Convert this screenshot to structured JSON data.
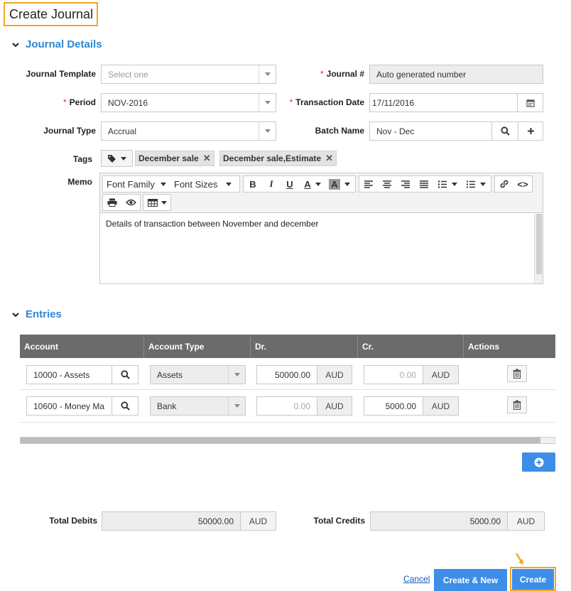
{
  "page": {
    "title": "Create Journal"
  },
  "journal_details": {
    "heading": "Journal Details",
    "journal_template": {
      "label": "Journal Template",
      "placeholder": "Select one"
    },
    "journal_number": {
      "label": "Journal #",
      "value": "Auto generated number"
    },
    "period": {
      "label": "Period",
      "value": "NOV-2016"
    },
    "transaction_date": {
      "label": "Transaction Date",
      "value": "17/11/2016"
    },
    "journal_type": {
      "label": "Journal Type",
      "value": "Accrual"
    },
    "batch_name": {
      "label": "Batch Name",
      "value": "Nov - Dec"
    },
    "tags": {
      "label": "Tags",
      "items": [
        "December sale",
        "December sale,Estimate"
      ]
    },
    "memo": {
      "label": "Memo",
      "toolbar": {
        "font_family": "Font Family",
        "font_sizes": "Font Sizes"
      },
      "content": "Details of  transaction between November and december"
    }
  },
  "entries": {
    "heading": "Entries",
    "columns": [
      "Account",
      "Account Type",
      "Dr.",
      "Cr.",
      "Actions"
    ],
    "rows": [
      {
        "account": "10000 - Assets",
        "account_type": "Assets",
        "dr": "50000.00",
        "dr_currency": "AUD",
        "cr": "0.00",
        "cr_currency": "AUD"
      },
      {
        "account": "10600 - Money Ma",
        "account_type": "Bank",
        "dr": "0.00",
        "dr_currency": "AUD",
        "cr": "5000.00",
        "cr_currency": "AUD"
      }
    ]
  },
  "totals": {
    "debits_label": "Total Debits",
    "debits_value": "50000.00",
    "debits_currency": "AUD",
    "credits_label": "Total Credits",
    "credits_value": "5000.00",
    "credits_currency": "AUD"
  },
  "footer": {
    "cancel": "Cancel",
    "create_new": "Create & New",
    "create": "Create"
  },
  "colors": {
    "accent_blue": "#3d8ee8",
    "heading_blue": "#2f86d6",
    "highlight_orange": "#f5a623",
    "table_header": "#6b6b6b",
    "required_red": "#d9302c"
  },
  "icons": [
    "chevron-down-icon",
    "search-icon",
    "plus-icon",
    "calendar-icon",
    "tag-icon",
    "close-icon",
    "trash-icon",
    "plus-circle-icon",
    "arrow-icon"
  ]
}
